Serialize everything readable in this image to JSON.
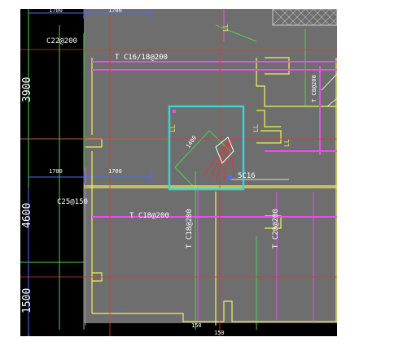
{
  "drawing": {
    "top_dims": [
      "1700",
      "1700"
    ],
    "mid_dims": [
      "1700",
      "1700"
    ],
    "left_dims": [
      "3900",
      "4600",
      "1500"
    ],
    "bottom_dims": [
      "150",
      "150"
    ],
    "rebar_labels": {
      "top_left": "C22@200",
      "top_main": "T C16/18@200",
      "right_vertical": "T C8@200",
      "mid_left": "C25@150",
      "mid_main": "T C18@200",
      "vert_a": "T C18@200",
      "vert_b": "T C20@200",
      "diag": "1400",
      "callout": "5C16",
      "small_a": "LL",
      "small_b": "LL",
      "small_c": "LL",
      "small_d": "LL"
    },
    "colors": {
      "background": "#6e6e6e",
      "black_band": "#000000",
      "yellow": "#f2f25a",
      "magenta": "#e84ee8",
      "red": "#d23c3c",
      "cyan": "#39d3d3",
      "blue": "#4a6cff",
      "green": "#4fd24f",
      "white": "#ffffff"
    }
  }
}
